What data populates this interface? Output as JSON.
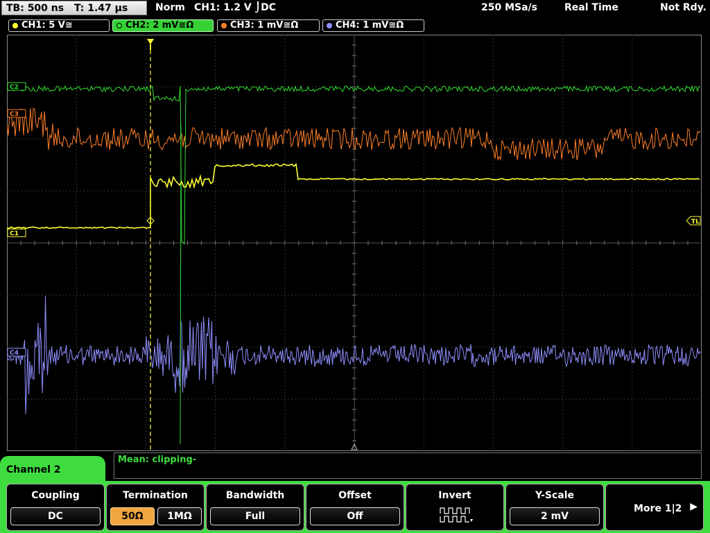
{
  "topbar": {
    "tb": "TB: 500 ns",
    "t": "T: 1.47 µs",
    "mode": "Norm",
    "trigger": "CH1: 1.2 V ⌡DC",
    "sample_rate": "250 MSa/s",
    "acq": "Real Time",
    "status": "Not Rdy."
  },
  "channels": [
    {
      "label": "CH1: 5 V≅",
      "color": "#ffff33",
      "active": false
    },
    {
      "label": "CH2: 2 mV≅Ω",
      "color": "#33dd33",
      "active": true
    },
    {
      "label": "CH3: 1 mV≅Ω",
      "color": "#ff7f27",
      "active": false
    },
    {
      "label": "CH4: 1 mV≅Ω",
      "color": "#8f8fff",
      "active": false
    }
  ],
  "markers": {
    "ch1": "C1",
    "ch2": "C2",
    "ch3": "C3",
    "ch4": "C4",
    "trigger_level": "TL"
  },
  "mean": "Mean: clipping-",
  "channel_title": "Channel 2",
  "softkeys": {
    "coupling": {
      "title": "Coupling",
      "value": "DC"
    },
    "termination": {
      "title": "Termination",
      "opt1": "50Ω",
      "opt2": "1MΩ"
    },
    "bandwidth": {
      "title": "Bandwidth",
      "value": "Full"
    },
    "offset": {
      "title": "Offset",
      "value": "Off"
    },
    "invert": {
      "title": "Invert"
    },
    "yscale": {
      "title": "Y-Scale",
      "value": "2 mV"
    },
    "more": {
      "label": "More 1|2",
      "arrow": "▶"
    }
  }
}
